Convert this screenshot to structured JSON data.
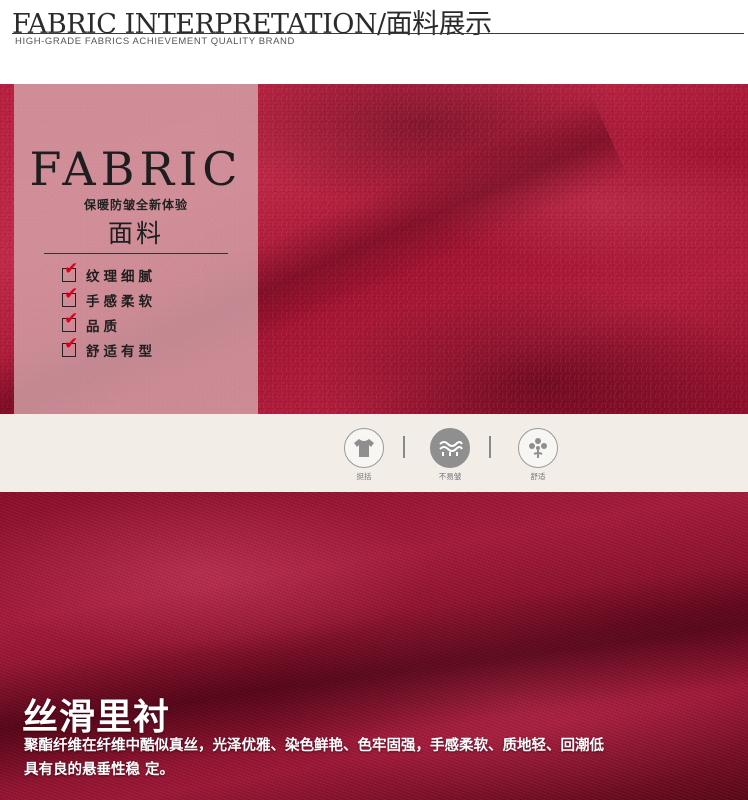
{
  "header": {
    "title": "FABRIC INTERPRETATION/面料展示",
    "subtitle": "HIGH-GRADE FABRICS ACHIEVEMENT QUALITY BRAND"
  },
  "panel": {
    "fabric_word": "FABRIC",
    "slogan": "保暖防皱全新体验",
    "title_cn": "面料",
    "features": [
      "纹理细腻",
      "手感柔软",
      "品质",
      "舒适有型"
    ]
  },
  "badges": [
    {
      "icon": "tshirt-icon",
      "label": "挺括"
    },
    {
      "icon": "wrinkle-resistant-icon",
      "label": "不易皱"
    },
    {
      "icon": "comfort-icon",
      "label": "舒适"
    }
  ],
  "lining": {
    "title": "丝滑里衬",
    "description_line1": "聚酯纤维在纤维中酷似真丝，光泽优雅、染色鲜艳、色牢固强，手感柔软、质地轻、回潮低",
    "description_line2": "具有良的悬垂性稳 定。"
  },
  "colors": {
    "felt": "#b8203f",
    "lining": "#8a0e2a",
    "panel_overlay": "#d6aab0",
    "check_red": "#e0001b",
    "strip_bg": "#f2ede7"
  }
}
